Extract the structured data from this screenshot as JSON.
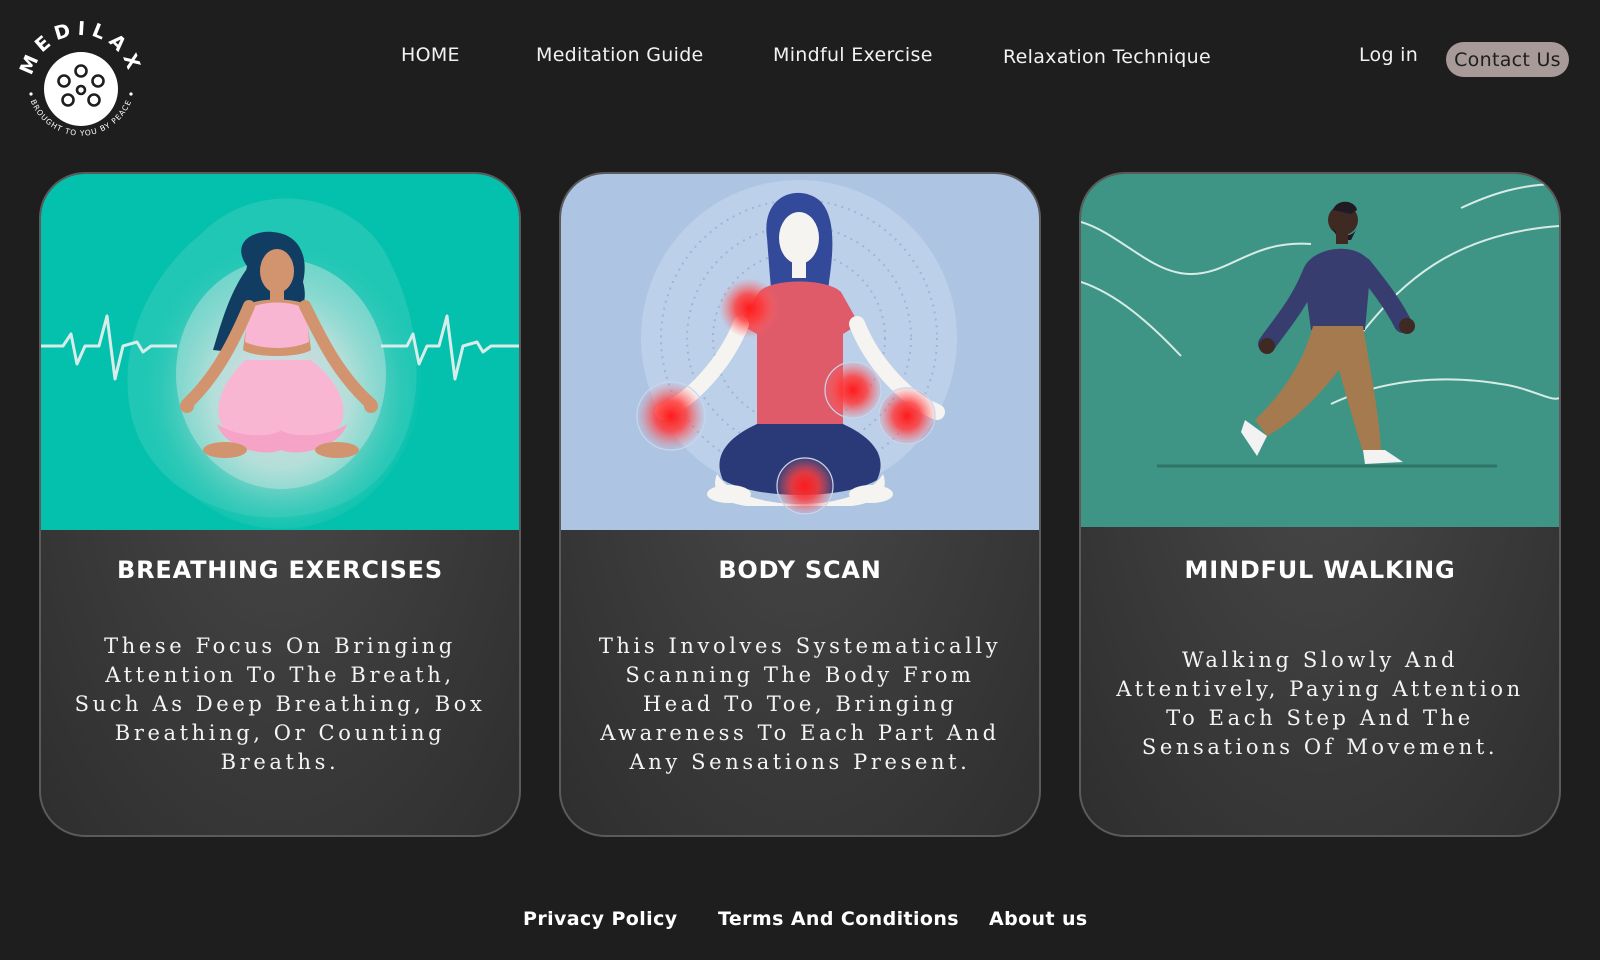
{
  "brand": {
    "name": "MEDILAX",
    "tagline": "BROUGHT TO YOU BY PEACE"
  },
  "nav": {
    "home": "HOME",
    "meditation_guide": "Meditation Guide",
    "mindful_exercise": "Mindful Exercise",
    "relaxation_technique": "Relaxation Technique",
    "login": "Log in",
    "contact": "Contact Us"
  },
  "cards": [
    {
      "title": "BREATHING EXERCISES",
      "description": "These Focus On Bringing Attention To The Breath, Such As Deep Breathing, Box Breathing, Or Counting Breaths.",
      "image_bg": "#03c1ad"
    },
    {
      "title": "BODY SCAN",
      "description": "This Involves Systematically Scanning The Body From Head To Toe, Bringing Awareness To Each Part And Any Sensations Present.",
      "image_bg": "#aec4e3"
    },
    {
      "title": "MINDFUL WALKING",
      "description": "Walking Slowly And Attentively, Paying Attention To Each Step And The Sensations Of Movement.",
      "image_bg": "#3e9585"
    }
  ],
  "footer": {
    "privacy": "Privacy Policy",
    "terms": "Terms And Conditions",
    "about": "About us"
  },
  "colors": {
    "page_bg": "#1e1e1f",
    "contact_bg": "#a79a99",
    "card_border": "#5b5b5c"
  }
}
